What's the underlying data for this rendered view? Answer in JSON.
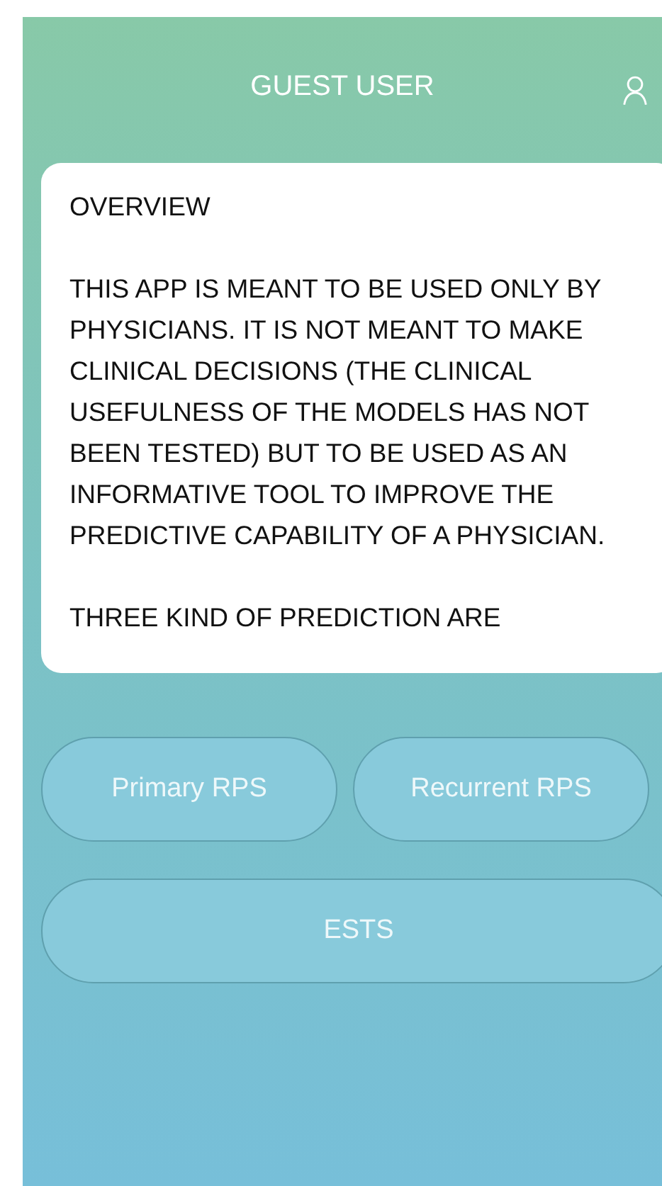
{
  "header": {
    "title": "GUEST USER"
  },
  "overview": {
    "title": "OVERVIEW",
    "paragraphs": [
      "THIS APP IS MEANT TO BE USED ONLY BY PHYSICIANS. IT IS NOT MEANT TO MAKE CLINICAL DECISIONS (THE CLINICAL USEFULNESS OF THE MODELS HAS NOT BEEN TESTED) BUT TO BE USED AS AN INFORMATIVE TOOL TO IMPROVE THE PREDICTIVE CAPABILITY OF A PHYSICIAN.",
      "THREE KIND OF PREDICTION ARE"
    ]
  },
  "buttons": [
    {
      "label": "Primary RPS",
      "kind": "half"
    },
    {
      "label": "Recurrent RPS",
      "kind": "half"
    },
    {
      "label": "ESTS",
      "kind": "full"
    }
  ]
}
